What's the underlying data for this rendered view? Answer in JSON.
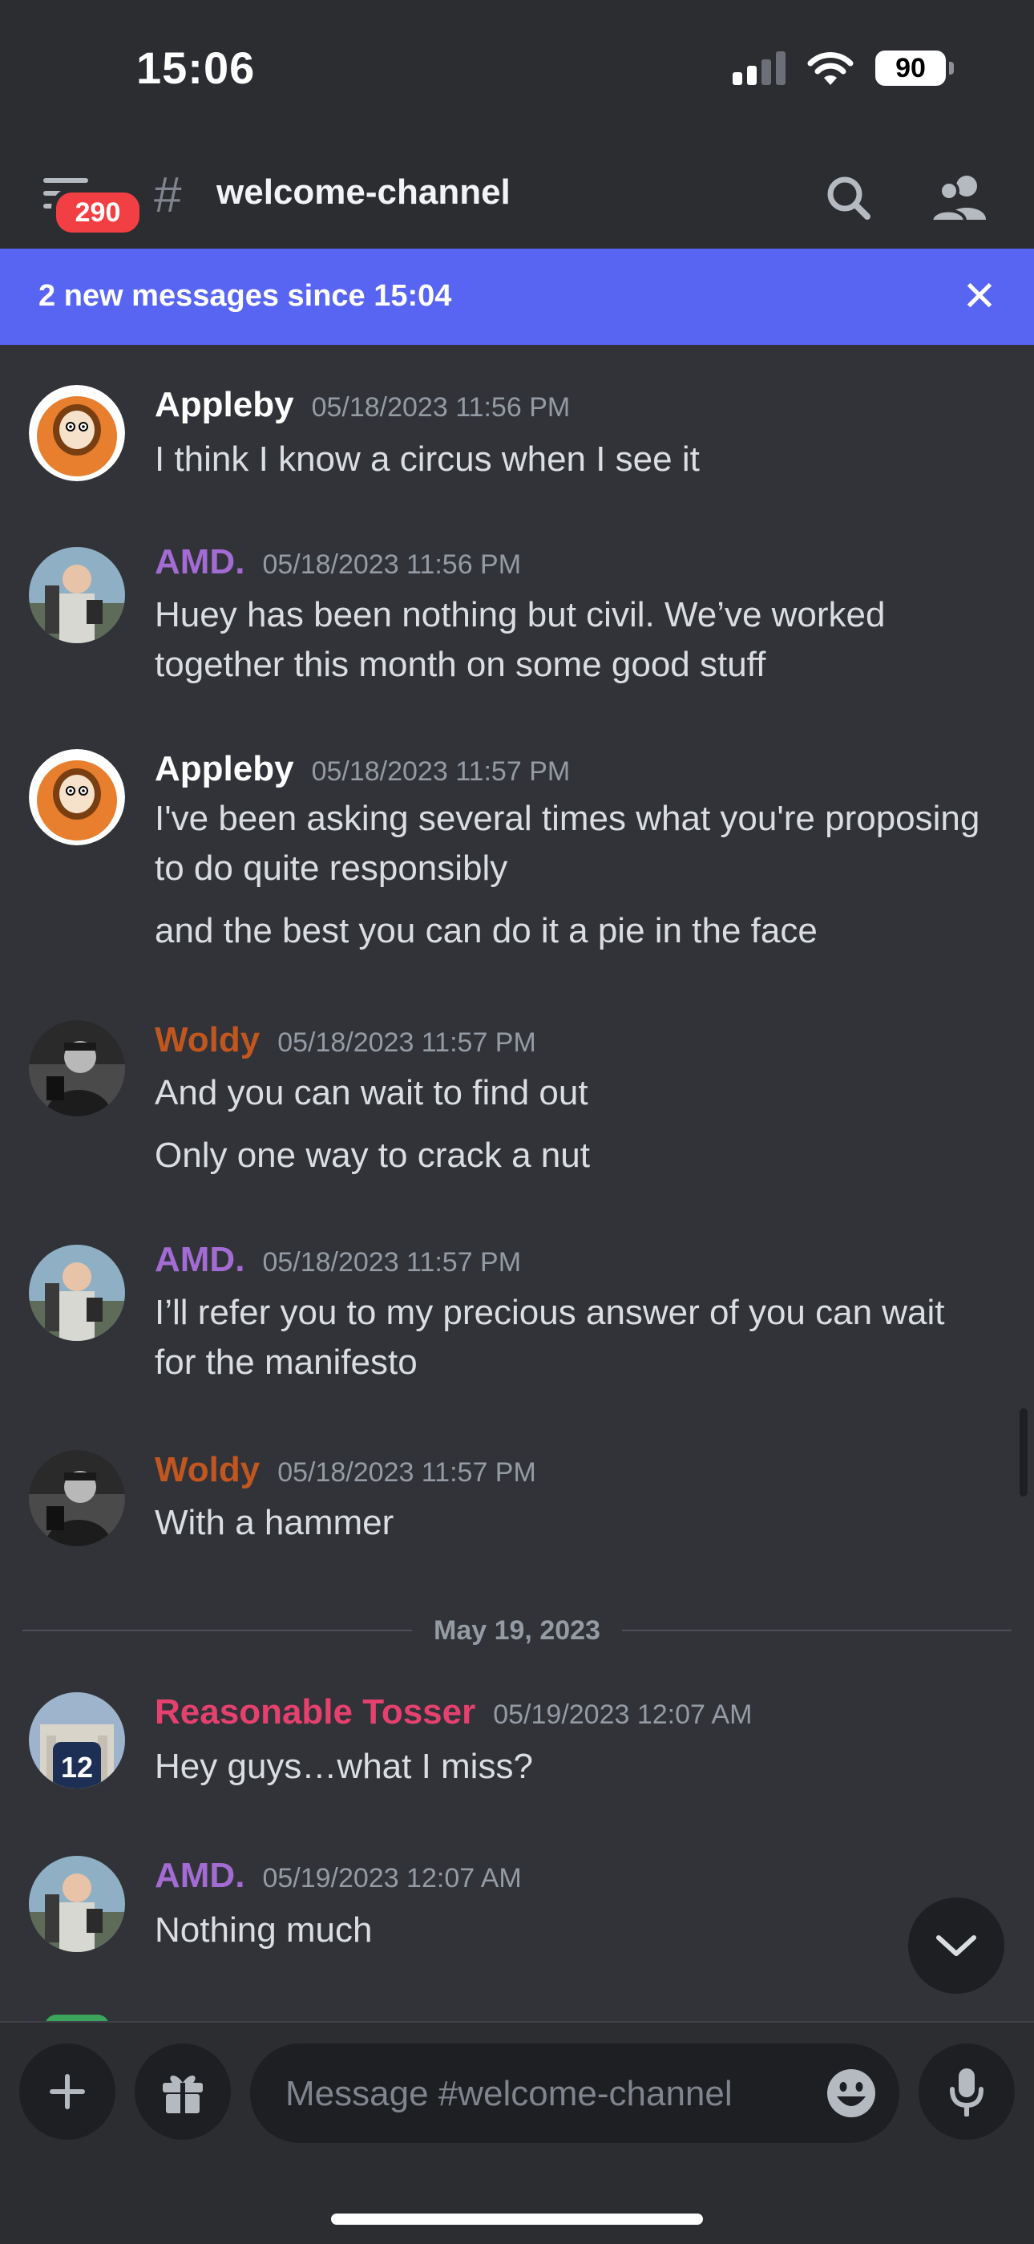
{
  "status_bar": {
    "time": "15:06",
    "battery": "90",
    "signal_bars_on": 2,
    "signal_bars_total": 4
  },
  "header": {
    "channel_hash": "#",
    "channel_name": "welcome-channel",
    "unread_badge": "290",
    "icons": [
      "menu-icon",
      "search-icon",
      "members-icon"
    ]
  },
  "new_messages_bar": {
    "text": "2 new messages since 15:04",
    "close_icon": "close-icon"
  },
  "colors": {
    "background": "#313338",
    "header": "#2b2d31",
    "accent": "#5865f2",
    "appleby": "#ffffff",
    "amd": "#a36bd4",
    "woldy": "#c2561f",
    "reasonable_tosser": "#e6416e"
  },
  "messages": [
    {
      "author": "Appleby",
      "time": "05/18/2023 11:56 PM",
      "lines": [
        "I think I know a circus when I see it"
      ]
    },
    {
      "author": "AMD.",
      "time": "05/18/2023 11:56 PM",
      "lines": [
        "Huey has been nothing but civil. We’ve worked",
        "together this month on some good stuff"
      ]
    },
    {
      "author": "Appleby",
      "time": "05/18/2023 11:57 PM",
      "lines": [
        "I've been asking several times what you're proposing",
        "to do quite responsibly",
        "and the best you can do it a pie in the face"
      ]
    },
    {
      "author": "Woldy",
      "time": "05/18/2023 11:57 PM",
      "lines": [
        "And you can wait to find out",
        "Only one way to crack a nut"
      ]
    },
    {
      "author": "AMD.",
      "time": "05/18/2023 11:57 PM",
      "lines": [
        "I’ll refer you to my precious answer of you can wait",
        "for the manifesto"
      ]
    },
    {
      "author": "Woldy",
      "time": "05/18/2023 11:57 PM",
      "lines": [
        "With a hammer"
      ]
    },
    {
      "author": "Reasonable Tosser",
      "time": "05/19/2023 12:07 AM",
      "lines": [
        "Hey guys…what I miss?"
      ]
    },
    {
      "author": "AMD.",
      "time": "05/19/2023 12:07 AM",
      "lines": [
        "Nothing much"
      ]
    }
  ],
  "date_divider": "May 19, 2023",
  "composer": {
    "placeholder": "Message #welcome-channel",
    "value": "",
    "icons": [
      "plus-icon",
      "gift-icon",
      "emoji-icon",
      "microphone-icon",
      "chevron-down-icon"
    ]
  }
}
